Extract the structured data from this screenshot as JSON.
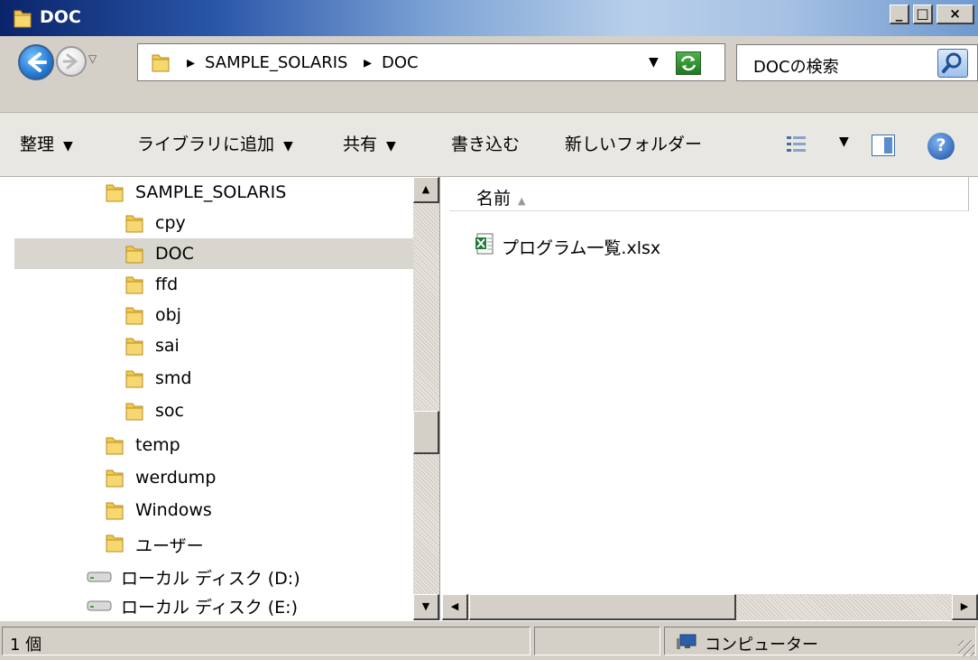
{
  "window": {
    "title": "DOC",
    "controls": {
      "minimize": "_",
      "maximize": "□",
      "close": "×"
    }
  },
  "address_bar": {
    "crumbs": [
      "SAMPLE_SOLARIS",
      "DOC"
    ],
    "separator": "▸"
  },
  "search": {
    "placeholder": "DOCの検索"
  },
  "toolbar": {
    "organize": "整理",
    "add_to_library": "ライブラリに追加",
    "share": "共有",
    "burn": "書き込む",
    "new_folder": "新しいフォルダー",
    "help": "?"
  },
  "nav_tree": {
    "items": [
      {
        "label": "SAMPLE_SOLARIS",
        "type": "folder",
        "indent": 1,
        "selected": false
      },
      {
        "label": "cpy",
        "type": "folder",
        "indent": 2,
        "selected": false
      },
      {
        "label": "DOC",
        "type": "folder",
        "indent": 2,
        "selected": true
      },
      {
        "label": "ffd",
        "type": "folder",
        "indent": 2,
        "selected": false
      },
      {
        "label": "obj",
        "type": "folder",
        "indent": 2,
        "selected": false
      },
      {
        "label": "sai",
        "type": "folder",
        "indent": 2,
        "selected": false
      },
      {
        "label": "smd",
        "type": "folder",
        "indent": 2,
        "selected": false
      },
      {
        "label": "soc",
        "type": "folder",
        "indent": 2,
        "selected": false
      },
      {
        "label": "temp",
        "type": "folder",
        "indent": 1,
        "selected": false
      },
      {
        "label": "werdump",
        "type": "folder",
        "indent": 1,
        "selected": false
      },
      {
        "label": "Windows",
        "type": "folder",
        "indent": 1,
        "selected": false
      },
      {
        "label": "ユーザー",
        "type": "folder",
        "indent": 1,
        "selected": false
      },
      {
        "label": "ローカル ディスク (D:)",
        "type": "drive",
        "indent": 0,
        "selected": false
      },
      {
        "label": "ローカル ディスク (E:)",
        "type": "drive",
        "indent": 0,
        "selected": false
      }
    ]
  },
  "file_list": {
    "column_name": "名前",
    "files": [
      {
        "name": "プログラム一覧.xlsx",
        "icon": "excel-icon"
      }
    ]
  },
  "status": {
    "count": "1 個",
    "location": "コンピューター"
  },
  "colors": {
    "title_gradient_start": "#0a246a",
    "selection": "#d9d6cf",
    "chrome": "#d4d0c8",
    "folder": "#f2c94c"
  }
}
